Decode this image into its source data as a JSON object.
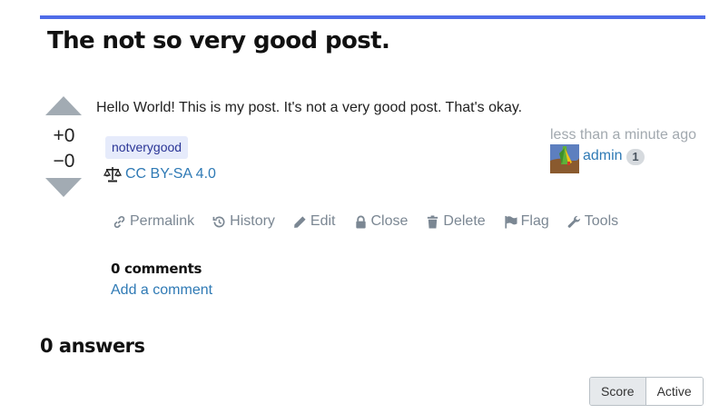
{
  "post": {
    "title": "The not so very good post.",
    "body": "Hello World! This is my post. It's not a very good post. That's okay.",
    "tags": [
      "notverygood"
    ],
    "license": "CC BY-SA 4.0"
  },
  "votes": {
    "up": "+0",
    "down": "−0"
  },
  "author": {
    "timestamp": "less than a minute ago",
    "name": "admin",
    "reputation": "1"
  },
  "tools": [
    {
      "label": "Permalink",
      "icon": "link-icon"
    },
    {
      "label": "History",
      "icon": "history-icon"
    },
    {
      "label": "Edit",
      "icon": "pencil-icon"
    },
    {
      "label": "Close",
      "icon": "lock-icon"
    },
    {
      "label": "Delete",
      "icon": "trash-icon"
    },
    {
      "label": "Flag",
      "icon": "flag-icon"
    },
    {
      "label": "Tools",
      "icon": "wrench-icon"
    }
  ],
  "comments": {
    "count_label": "0 comments",
    "add_label": "Add a comment"
  },
  "answers": {
    "heading": "0 answers",
    "sort_options": [
      "Score",
      "Active"
    ],
    "selected_sort": "Score"
  },
  "colors": {
    "accent": "#4f6ce8",
    "link": "#2f7ab5",
    "muted": "#7b8793"
  }
}
